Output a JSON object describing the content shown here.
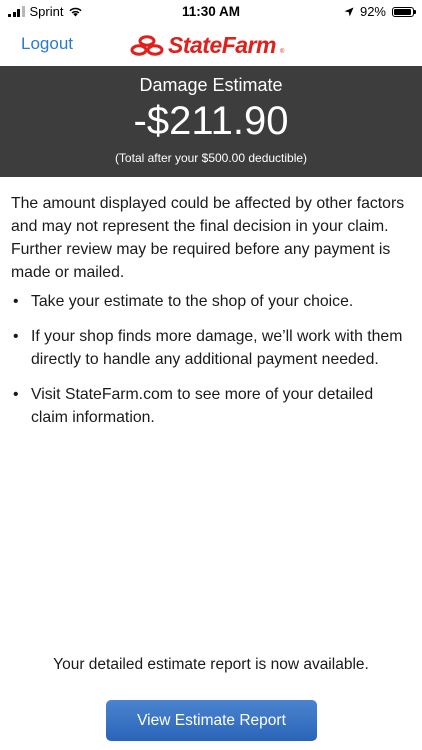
{
  "status_bar": {
    "carrier": "Sprint",
    "time": "11:30 AM",
    "battery": "92%",
    "battery_level": 0.92
  },
  "nav": {
    "logout_label": "Logout",
    "brand": "StateFarm",
    "brand_color": "#e0201a",
    "link_color": "#2a7ad6"
  },
  "estimate": {
    "title": "Damage Estimate",
    "amount": "-$211.90",
    "note": "(Total after your $500.00 deductible)",
    "panel_color": "#3d3d3d"
  },
  "disclaimer": "The amount displayed could be affected by other factors and may not represent the final decision in your claim. Further review may be required before any payment is made or mailed.",
  "bullets": [
    "Take your estimate to the shop of your choice.",
    "If your shop finds more damage, we’ll work with them directly to handle any additional payment needed.",
    "Visit StateFarm.com to see more of your detailed claim information."
  ],
  "report": {
    "note": "Your detailed estimate report is now available.",
    "button_label": "View Estimate Report",
    "button_color": "#2a64b8"
  }
}
